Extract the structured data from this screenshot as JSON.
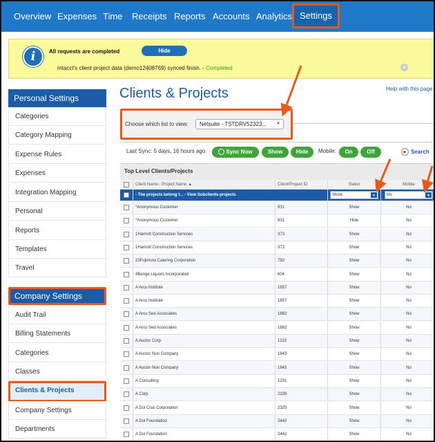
{
  "nav": {
    "tabs": [
      {
        "label": "Overview"
      },
      {
        "label": "Expenses"
      },
      {
        "label": "Time"
      },
      {
        "label": "Receipts"
      },
      {
        "label": "Reports"
      },
      {
        "label": "Accounts"
      },
      {
        "label": "Analytics"
      },
      {
        "label": "Settings",
        "active": true
      }
    ]
  },
  "banner": {
    "title": "All requests are completed",
    "hide_label": "Hide",
    "message": "Intacct's client project data (demo12408769) synced finish. - ",
    "status": "Completed",
    "close_icon": "close-circle-icon"
  },
  "sidebar": {
    "personal_heading": "Personal Settings",
    "personal_items": [
      "Categories",
      "Category Mapping",
      "Expense Rules",
      "Expenses",
      "Integration Mapping",
      "Personal",
      "Reports",
      "Templates",
      "Travel"
    ],
    "company_heading": "Company Settings",
    "company_items": [
      "Audit Trail",
      "Billing Statements",
      "Categories",
      "Classes",
      "Clients & Projects",
      "Company Settings",
      "Departments"
    ],
    "active_item": "Clients & Projects"
  },
  "main": {
    "title": "Clients & Projects",
    "help": "Help with this page",
    "chooser_label": "Choose which list to view:",
    "chooser_value": "Netsuite - TSTDRV52323...",
    "last_sync": "Last Sync: 5 days, 16 hours ago",
    "sync_now": "Sync Now",
    "show": "Show",
    "hide": "Hide",
    "mobile_label": "Mobile:",
    "on": "On",
    "off": "Off",
    "search": "Search",
    "grid_title": "Top Level Clients/Projects"
  },
  "table": {
    "columns": [
      "Client Name : Project Name",
      "Client/Project ID",
      "Status",
      "Mobile"
    ],
    "group_row": {
      "label": "- The projects belong t... - View Subclients-projects",
      "status_filter": "Show",
      "mobile_filter": "No"
    },
    "rows": [
      {
        "name": "*Anonymous Customer",
        "id": "931",
        "status": "Show",
        "mobile": "No"
      },
      {
        "name": "*Anonymous Customer",
        "id": "931",
        "status": "Hide",
        "mobile": "No"
      },
      {
        "name": "1Harriott Construction Services",
        "id": "373",
        "status": "Show",
        "mobile": "No"
      },
      {
        "name": "1Harriott Construction Services",
        "id": "373",
        "status": "Show",
        "mobile": "No"
      },
      {
        "name": "23Fujimura Catering Corporation",
        "id": "792",
        "status": "Show",
        "mobile": "No"
      },
      {
        "name": "4Benge Liquors Incorporated",
        "id": "604",
        "status": "Show",
        "mobile": "No"
      },
      {
        "name": "A Arcu Institute",
        "id": "1657",
        "status": "Show",
        "mobile": "No"
      },
      {
        "name": "A Arcu Institute",
        "id": "1657",
        "status": "Show",
        "mobile": "No"
      },
      {
        "name": "A Arcu Sed Associates",
        "id": "1882",
        "status": "Show",
        "mobile": "No"
      },
      {
        "name": "A Arcu Sed Associates",
        "id": "1882",
        "status": "Show",
        "mobile": "No"
      },
      {
        "name": "A Auctor Corp.",
        "id": "1222",
        "status": "Show",
        "mobile": "No"
      },
      {
        "name": "A Auctor Non Company",
        "id": "1843",
        "status": "Show",
        "mobile": "No"
      },
      {
        "name": "A Auctor Non Company",
        "id": "1843",
        "status": "Show",
        "mobile": "No"
      },
      {
        "name": "A Consulting",
        "id": "1231",
        "status": "Show",
        "mobile": "No"
      },
      {
        "name": "A Corp.",
        "id": "2326",
        "status": "Show",
        "mobile": "No"
      },
      {
        "name": "A Dui Cras Corporation",
        "id": "2325",
        "status": "Show",
        "mobile": "No"
      },
      {
        "name": "A Dui Foundation",
        "id": "2442",
        "status": "Show",
        "mobile": "No"
      },
      {
        "name": "A Dui Foundation",
        "id": "2442",
        "status": "Show",
        "mobile": "No"
      }
    ]
  },
  "colors": {
    "nav_bg": "#1f78c8",
    "accent": "#1c5ca6",
    "highlight": "#e9591b",
    "green": "#3fa53a",
    "banner_bg": "#fbfa9a"
  }
}
